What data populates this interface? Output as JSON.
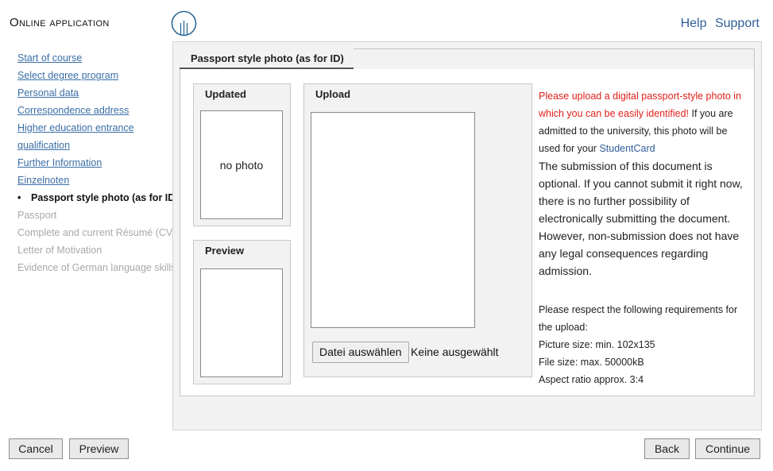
{
  "header": {
    "app_title": "Online application",
    "links": [
      "Help",
      "Support"
    ]
  },
  "sidebar": {
    "items": [
      {
        "label": "Start of course",
        "state": "link"
      },
      {
        "label": "Select degree program",
        "state": "link"
      },
      {
        "label": "Personal data",
        "state": "link"
      },
      {
        "label": "Correspondence address",
        "state": "link"
      },
      {
        "label": "Higher education entrance",
        "state": "link"
      },
      {
        "label": "qualification",
        "state": "link"
      },
      {
        "label": "Further Information",
        "state": "link"
      },
      {
        "label": "Einzelnoten",
        "state": "link"
      },
      {
        "label": "Passport style photo (as for ID)",
        "state": "active"
      },
      {
        "label": "Passport",
        "state": "disabled"
      },
      {
        "label": "Complete and current Résumé (CV)",
        "state": "disabled"
      },
      {
        "label": "Letter of Motivation",
        "state": "disabled"
      },
      {
        "label": "Evidence of German language skills",
        "state": "disabled"
      }
    ]
  },
  "panel": {
    "tab_title": "Passport style photo (as for ID)",
    "updated": {
      "heading": "Updated",
      "placeholder": "no photo"
    },
    "preview": {
      "heading": "Preview"
    },
    "upload": {
      "heading": "Upload",
      "choose_button": "Datei auswählen",
      "file_status": "Keine ausgewählt"
    },
    "info": {
      "red_text": "Please upload a digital passport-style photo in which you can be easily identified!",
      "text1": " If you are admitted to the university, this photo will be used for your ",
      "link": "StudentCard",
      "optional_text": "The submission of this document is optional. If you cannot submit it right now, there is no further possibility of electronically submitting the document. However, non-submission does not have any legal consequences regarding admission.",
      "req_heading": "Please respect the following requirements for the upload:",
      "requirements": [
        "Picture size: min. 102x135",
        "File size: max. 50000kB",
        "Aspect ratio approx. 3:4"
      ]
    }
  },
  "footer": {
    "cancel": "Cancel",
    "preview": "Preview",
    "back": "Back",
    "continue": "Continue"
  },
  "colors": {
    "link": "#2f5f9a",
    "warning": "#e0201b",
    "disabled": "#a8a8a8"
  }
}
